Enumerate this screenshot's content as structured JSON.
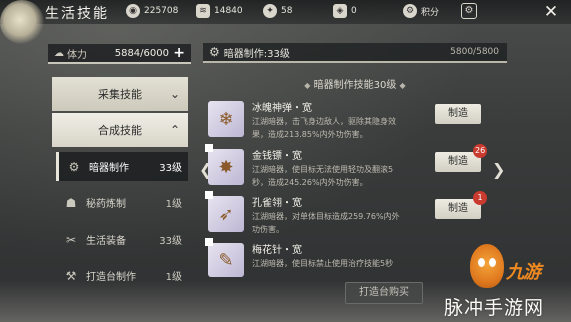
{
  "app": {
    "title": "生活技能"
  },
  "resources": [
    {
      "icon": "coin-icon",
      "value": "225708"
    },
    {
      "icon": "silver-icon",
      "value": "14840"
    },
    {
      "icon": "gem-icon",
      "value": "58"
    },
    {
      "icon": "token-icon",
      "value": "0"
    },
    {
      "icon": "points-icon",
      "value": "积分"
    }
  ],
  "left": {
    "stamina_label": "体力",
    "stamina_value": "5884/6000",
    "stamina_plus": "+",
    "categories": [
      {
        "label": "采集技能",
        "chevron": "⌄"
      },
      {
        "label": "合成技能",
        "chevron": "⌃"
      }
    ],
    "skills": [
      {
        "name": "暗器制作",
        "level": "33级",
        "icon": "⚙"
      },
      {
        "name": "秘药炼制",
        "level": "1级",
        "icon": "☗"
      },
      {
        "name": "生活装备",
        "level": "33级",
        "icon": "✂"
      },
      {
        "name": "打造台制作",
        "level": "1级",
        "icon": "⚒"
      }
    ]
  },
  "right": {
    "header": "暗器制作:33级",
    "hp": "5800/5800",
    "section_title": "暗器制作技能30级",
    "items": [
      {
        "name": "冰魄神弹・宽",
        "desc1": "江湖暗器，击飞身边敌人，驱除其隐身效",
        "desc2": "果，造成213.85%内外功伤害。",
        "craft": "制造",
        "badge": ""
      },
      {
        "name": "金钱镖・宽",
        "desc1": "江湖暗器，使目标无法使用轻功及翻滚5",
        "desc2": "秒，造成245.26%内外功伤害。",
        "craft": "制造",
        "badge": "26"
      },
      {
        "name": "孔雀翎・宽",
        "desc1": "江湖暗器，对单体目标造成259.76%内外",
        "desc2": "功伤害。",
        "craft": "制造",
        "badge": "1"
      },
      {
        "name": "梅花针・宽",
        "desc1": "江湖暗器，使目标禁止使用治疗技能5秒",
        "desc2": "",
        "craft": "",
        "badge": ""
      }
    ],
    "buy_button": "打造台购买"
  },
  "watermark": {
    "brand": "九游",
    "site": "脉冲手游网"
  },
  "colors": {
    "badge": "#c93a2f",
    "brand_orange": "#f08a20"
  }
}
